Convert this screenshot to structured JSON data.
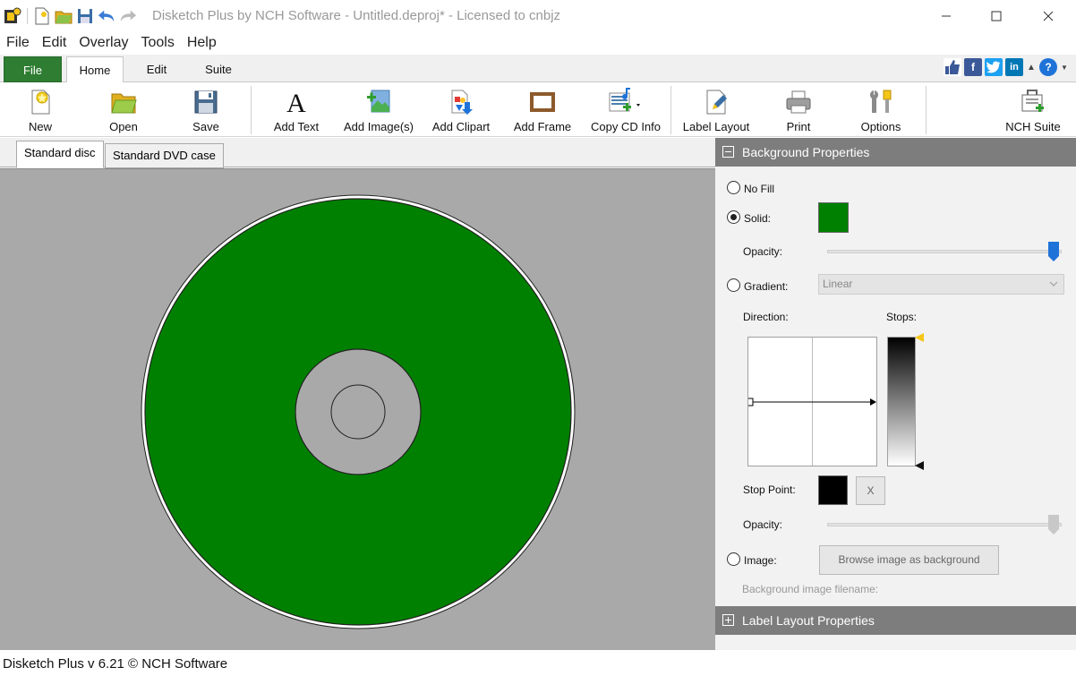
{
  "window": {
    "title": "Disketch Plus by NCH Software - Untitled.deproj* - Licensed to cnbjz"
  },
  "menu": [
    "File",
    "Edit",
    "Overlay",
    "Tools",
    "Help"
  ],
  "ribbon_tabs": {
    "file": "File",
    "home": "Home",
    "edit": "Edit",
    "suite": "Suite"
  },
  "toolbar": {
    "new": "New",
    "open": "Open",
    "save": "Save",
    "add_text": "Add Text",
    "add_images": "Add Image(s)",
    "add_clipart": "Add Clipart",
    "add_frame": "Add Frame",
    "copy_cd_info": "Copy CD Info",
    "label_layout": "Label Layout",
    "print": "Print",
    "options": "Options",
    "nch_suite": "NCH Suite"
  },
  "doc_tabs": {
    "standard_disc": "Standard disc",
    "standard_dvd_case": "Standard DVD case"
  },
  "disc": {
    "fill_color": "#008000",
    "hub_color": "#a9a9a9"
  },
  "background_panel": {
    "header": "Background Properties",
    "no_fill": "No Fill",
    "solid": "Solid:",
    "solid_color": "#008000",
    "opacity_label": "Opacity:",
    "opacity_value": 1.0,
    "gradient": "Gradient:",
    "gradient_type": "Linear",
    "direction": "Direction:",
    "stops": "Stops:",
    "stop_point": "Stop Point:",
    "stop_color": "#000000",
    "stop_remove": "X",
    "opacity2_label": "Opacity:",
    "opacity2_value": 1.0,
    "image": "Image:",
    "browse_button": "Browse image as background",
    "filename_label": "Background image filename:"
  },
  "label_layout_panel": {
    "header": "Label Layout Properties"
  },
  "status": {
    "text": "Disketch Plus v 6.21 © NCH Software"
  },
  "colors": {
    "file_tab": "#2e7d32",
    "panel_header": "#7d7d7d",
    "accent_blue": "#1e73d8"
  }
}
